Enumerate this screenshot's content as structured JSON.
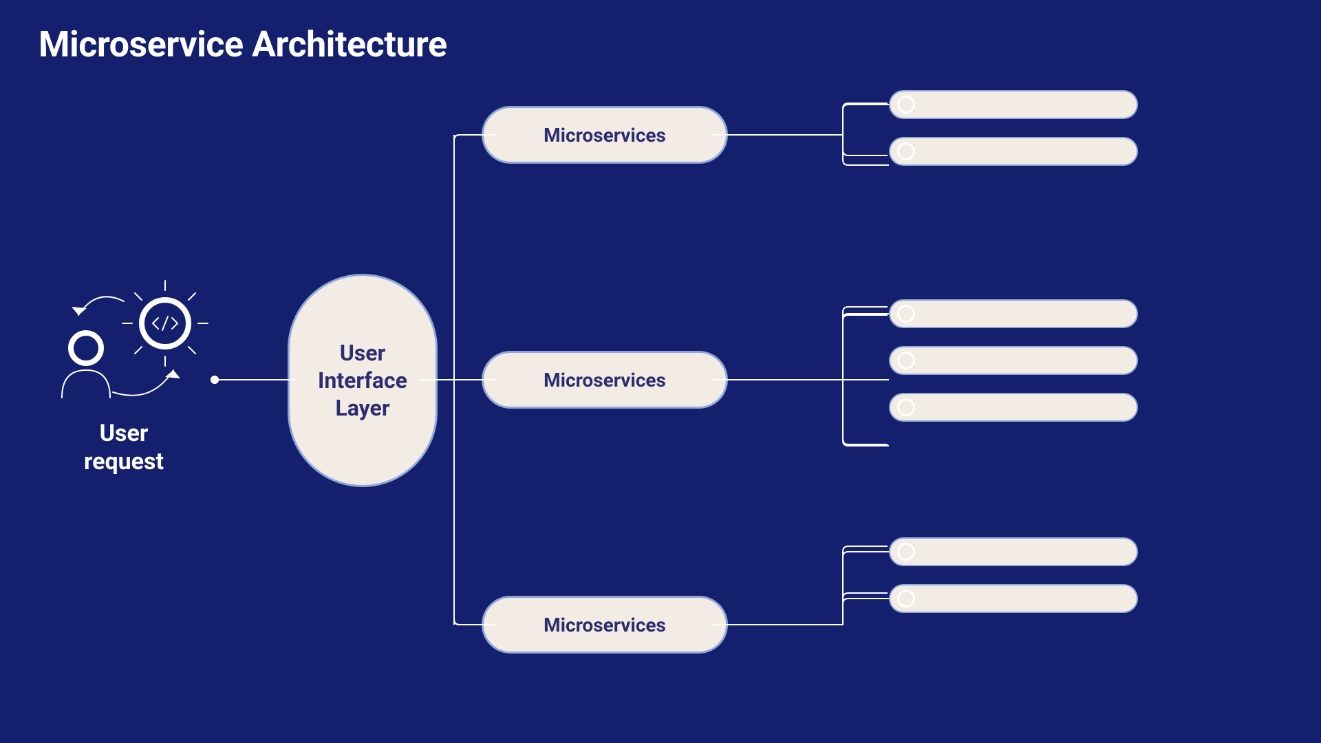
{
  "title": "Microservice Architecture",
  "user_request_label": "User\nrequest",
  "ui_layer_label": "User\nInterface\nLayer",
  "microservices": {
    "a": "Microservices",
    "b": "Microservices",
    "c": "Microservices"
  },
  "capsule_counts": {
    "a": 2,
    "b": 3,
    "c": 2
  },
  "colors": {
    "bg": "#14206e",
    "pill_bg": "#f2ece5",
    "pill_text": "#2c2d6f",
    "pill_border": "#8fa8d9",
    "wire": "#ffffff"
  }
}
